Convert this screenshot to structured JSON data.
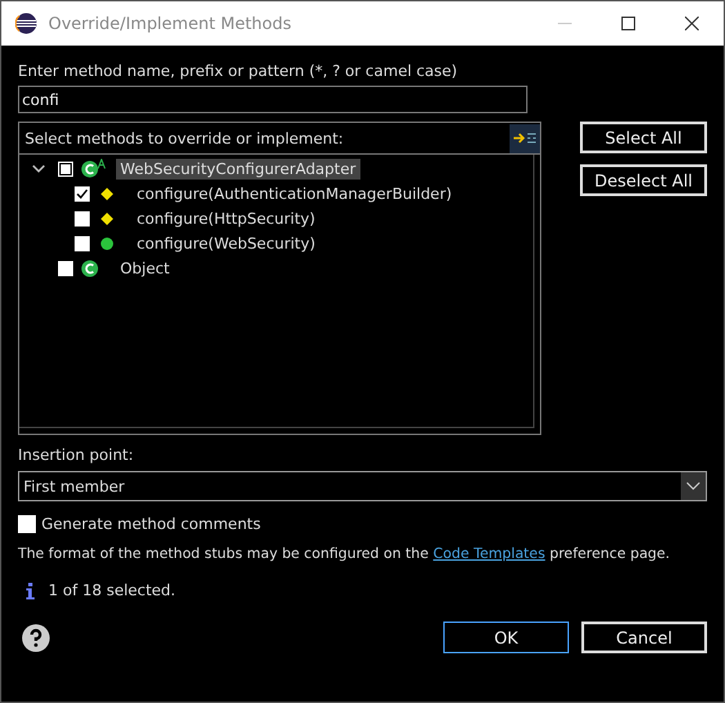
{
  "window": {
    "title": "Override/Implement Methods"
  },
  "filter": {
    "label": "Enter method name, prefix or pattern (*, ? or camel case)",
    "value": "confi"
  },
  "methods": {
    "label": "Select methods to override or implement:",
    "tree": [
      {
        "kind": "class",
        "label": "WebSecurityConfigurerAdapter",
        "abstract": true,
        "expanded": true,
        "checked": false,
        "partial": true,
        "selected": true,
        "children": [
          {
            "kind": "protected",
            "label": "configure(AuthenticationManagerBuilder)",
            "checked": true,
            "selected": false
          },
          {
            "kind": "protected",
            "label": "configure(HttpSecurity)",
            "checked": false,
            "selected": false
          },
          {
            "kind": "public",
            "label": "configure(WebSecurity)",
            "checked": false,
            "selected": false
          }
        ]
      },
      {
        "kind": "class",
        "label": "Object",
        "abstract": false,
        "expanded": false,
        "checked": false,
        "partial": false,
        "selected": false
      }
    ]
  },
  "side_buttons": [
    "Select All",
    "Deselect All"
  ],
  "insertion": {
    "label": "Insertion point:",
    "value": "First member"
  },
  "generate_comments": {
    "label": "Generate method comments",
    "checked": false
  },
  "note": {
    "before": "The format of the method stubs may be configured on the ",
    "link": "Code Templates",
    "after": " preference page."
  },
  "status": "1 of 18 selected.",
  "buttons": [
    {
      "label": "OK",
      "default": true
    },
    {
      "label": "Cancel",
      "default": false
    }
  ]
}
